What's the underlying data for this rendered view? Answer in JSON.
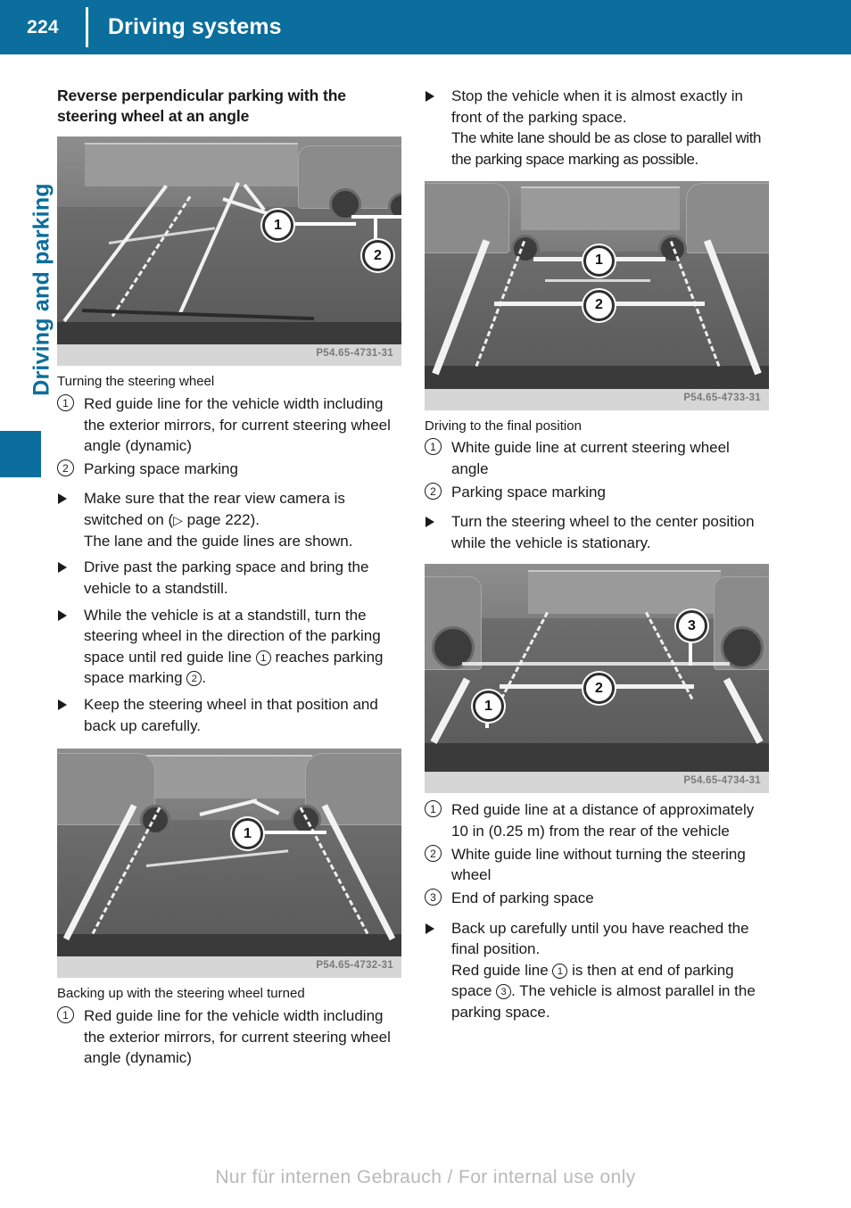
{
  "header": {
    "page_number": "224",
    "title": "Driving systems"
  },
  "side_tab": {
    "label": "Driving and parking"
  },
  "footer": {
    "watermark": "Nur für internen Gebrauch / For internal use only"
  },
  "colors": {
    "brand_blue": "#0b6e9c",
    "text": "#1a1a1a",
    "caption_code": "#7a7a7a",
    "watermark": "#b9b9b9"
  },
  "left_column": {
    "section_title": "Reverse perpendicular parking with the steering wheel at an angle",
    "figure_1": {
      "code": "P54.65-4731-31",
      "markers": [
        "1",
        "2"
      ]
    },
    "caption_1": "Turning the steering wheel",
    "legend_1": [
      {
        "num": "1",
        "text": "Red guide line for the vehicle width including the exterior mirrors, for current steering wheel angle (dynamic)"
      },
      {
        "num": "2",
        "text": "Parking space marking"
      }
    ],
    "steps_1": [
      {
        "lines": [
          "Make sure that the rear view camera is switched on (▷ page 222).",
          "The lane and the guide lines are shown."
        ]
      },
      {
        "lines": [
          "Drive past the parking space and bring the vehicle to a standstill."
        ]
      },
      {
        "lines": [
          "While the vehicle is at a standstill, turn the steering wheel in the direction of the parking space until red guide line ① reaches parking space marking ②."
        ]
      },
      {
        "lines": [
          "Keep the steering wheel in that position and back up carefully."
        ]
      }
    ],
    "figure_2": {
      "code": "P54.65-4732-31",
      "markers": [
        "1"
      ]
    },
    "caption_2": "Backing up with the steering wheel turned",
    "legend_2": [
      {
        "num": "1",
        "text": "Red guide line for the vehicle width including the exterior mirrors, for current steering wheel angle (dynamic)"
      }
    ]
  },
  "right_column": {
    "steps_top": [
      {
        "lines": [
          "Stop the vehicle when it is almost exactly in front of the parking space.",
          "The white lane should be as close to parallel with the parking space marking as possible."
        ]
      }
    ],
    "figure_3": {
      "code": "P54.65-4733-31",
      "markers": [
        "1",
        "2"
      ]
    },
    "caption_3": "Driving to the final position",
    "legend_3": [
      {
        "num": "1",
        "text": "White guide line at current steering wheel angle"
      },
      {
        "num": "2",
        "text": "Parking space marking"
      }
    ],
    "steps_mid": [
      {
        "lines": [
          "Turn the steering wheel to the center position while the vehicle is stationary."
        ]
      }
    ],
    "figure_4": {
      "code": "P54.65-4734-31",
      "markers": [
        "1",
        "2",
        "3"
      ]
    },
    "legend_4": [
      {
        "num": "1",
        "text": "Red guide line at a distance of approximately 10 in (0.25 m) from the rear of the vehicle"
      },
      {
        "num": "2",
        "text": "White guide line without turning the steering wheel"
      },
      {
        "num": "3",
        "text": "End of parking space"
      }
    ],
    "steps_bottom": [
      {
        "lines": [
          "Back up carefully until you have reached the final position.",
          "Red guide line ① is then at end of parking space ③. The vehicle is almost parallel in the parking space."
        ]
      }
    ]
  }
}
